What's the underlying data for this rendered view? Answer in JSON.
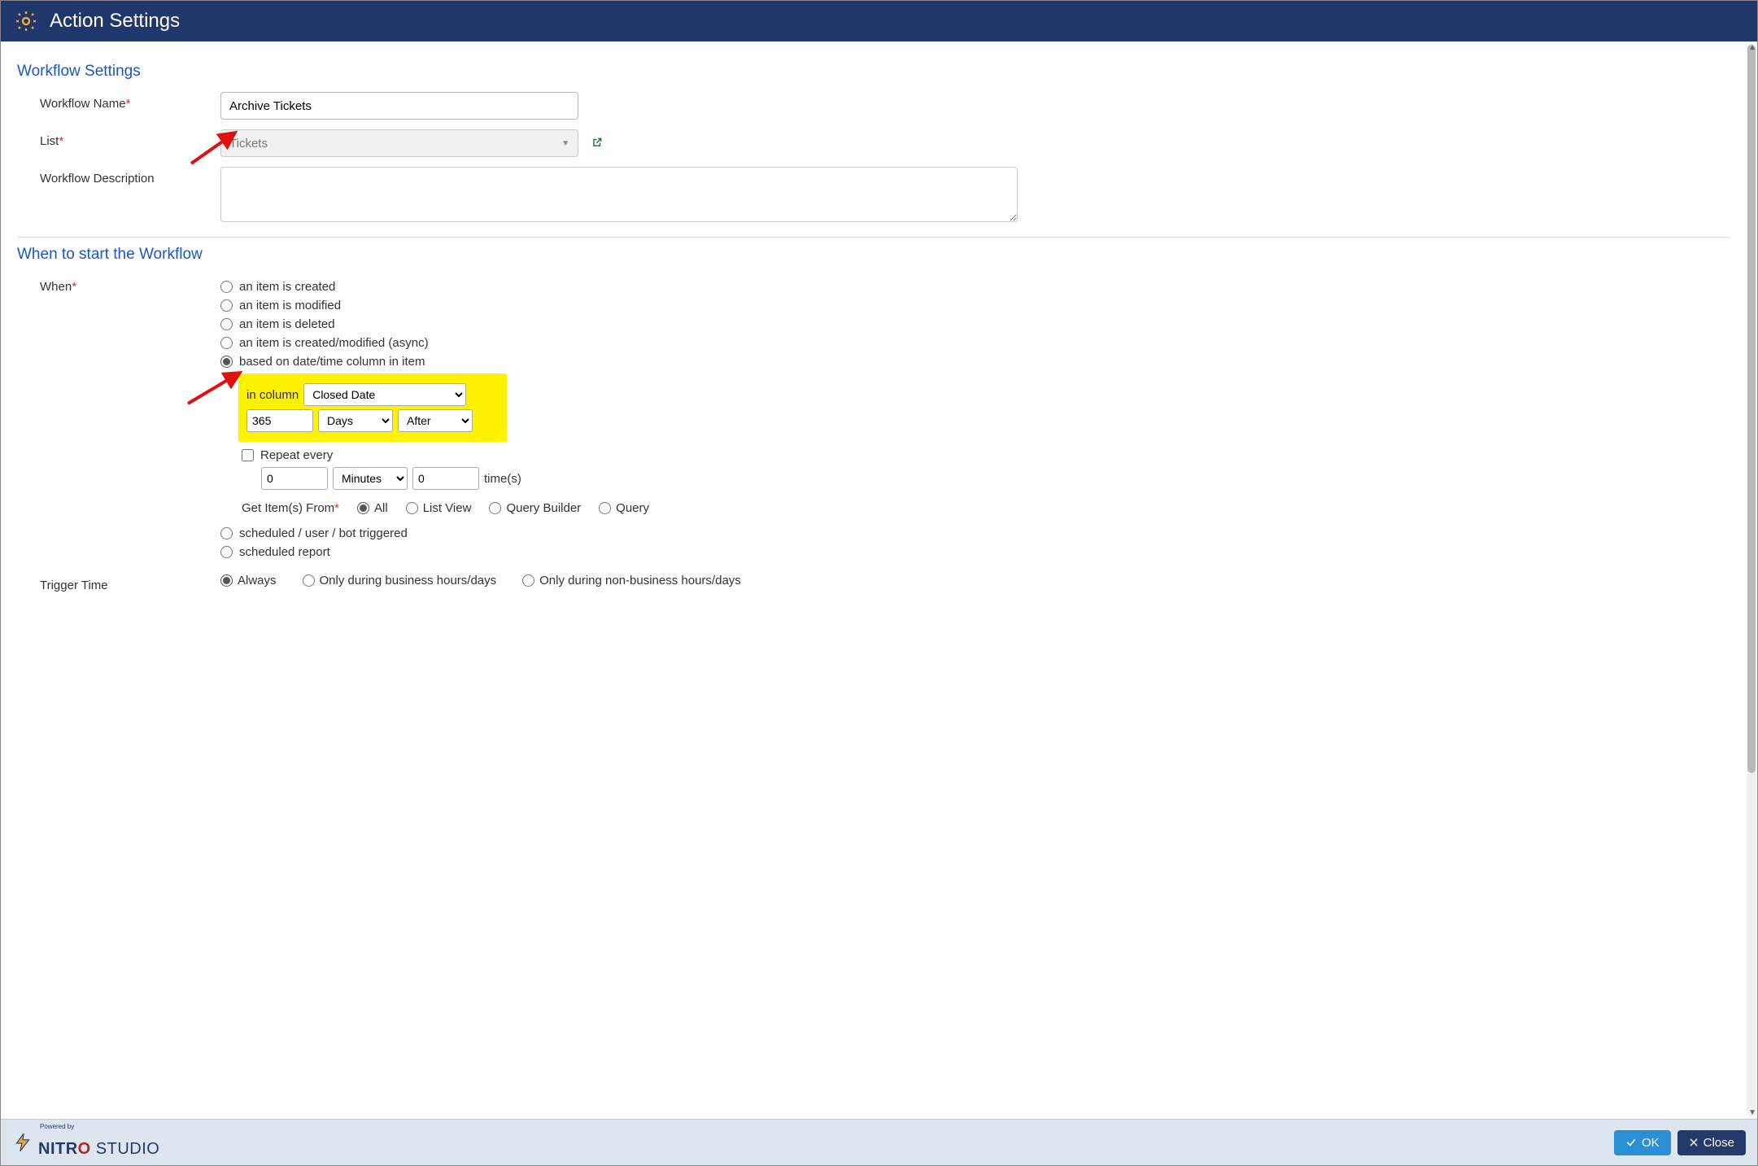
{
  "header": {
    "title": "Action Settings"
  },
  "sections": {
    "workflow": {
      "title": "Workflow Settings",
      "labels": {
        "name": "Workflow Name",
        "list": "List",
        "desc": "Workflow Description"
      },
      "values": {
        "name": "Archive Tickets",
        "list": "Tickets",
        "desc": ""
      }
    },
    "when": {
      "title": "When to start the Workflow",
      "label": "When",
      "options": {
        "created": "an item is created",
        "modified": "an item is modified",
        "deleted": "an item is deleted",
        "created_modified_async": "an item is created/modified (async)",
        "date_column": "based on date/time column in item",
        "scheduled": "scheduled / user / bot triggered",
        "scheduled_report": "scheduled report"
      },
      "date_cfg": {
        "in_column_label": "in column",
        "column": "Closed Date",
        "offset_value": "365",
        "offset_unit": "Days",
        "offset_direction": "After"
      },
      "repeat": {
        "label": "Repeat every",
        "interval": "0",
        "unit": "Minutes",
        "times": "0",
        "times_suffix": "time(s)"
      },
      "get_items": {
        "label": "Get Item(s) From",
        "options": {
          "all": "All",
          "list_view": "List View",
          "query_builder": "Query Builder",
          "query": "Query"
        }
      }
    },
    "trigger": {
      "label": "Trigger Time",
      "options": {
        "always": "Always",
        "business": "Only during business hours/days",
        "nonbusiness": "Only during non-business hours/days"
      }
    }
  },
  "footer": {
    "powered_by": "Powered by",
    "brand1": "NITR",
    "brand2": "O",
    "brand3": " STUDIO",
    "ok": "OK",
    "close": "Close"
  }
}
